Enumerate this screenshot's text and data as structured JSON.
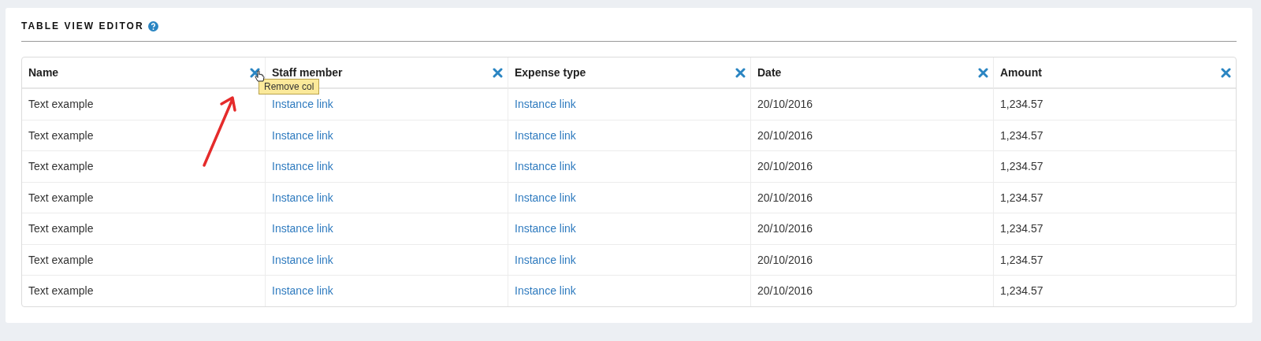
{
  "panel": {
    "title": "TABLE VIEW EDITOR"
  },
  "table": {
    "columns": [
      {
        "label": "Name",
        "kind": "text",
        "tooltip": "Remove col"
      },
      {
        "label": "Staff member",
        "kind": "link"
      },
      {
        "label": "Expense type",
        "kind": "link"
      },
      {
        "label": "Date",
        "kind": "text"
      },
      {
        "label": "Amount",
        "kind": "text"
      }
    ],
    "rows": [
      [
        "Text example",
        "Instance link",
        "Instance link",
        "20/10/2016",
        "1,234.57"
      ],
      [
        "Text example",
        "Instance link",
        "Instance link",
        "20/10/2016",
        "1,234.57"
      ],
      [
        "Text example",
        "Instance link",
        "Instance link",
        "20/10/2016",
        "1,234.57"
      ],
      [
        "Text example",
        "Instance link",
        "Instance link",
        "20/10/2016",
        "1,234.57"
      ],
      [
        "Text example",
        "Instance link",
        "Instance link",
        "20/10/2016",
        "1,234.57"
      ],
      [
        "Text example",
        "Instance link",
        "Instance link",
        "20/10/2016",
        "1,234.57"
      ],
      [
        "Text example",
        "Instance link",
        "Instance link",
        "20/10/2016",
        "1,234.57"
      ]
    ]
  }
}
